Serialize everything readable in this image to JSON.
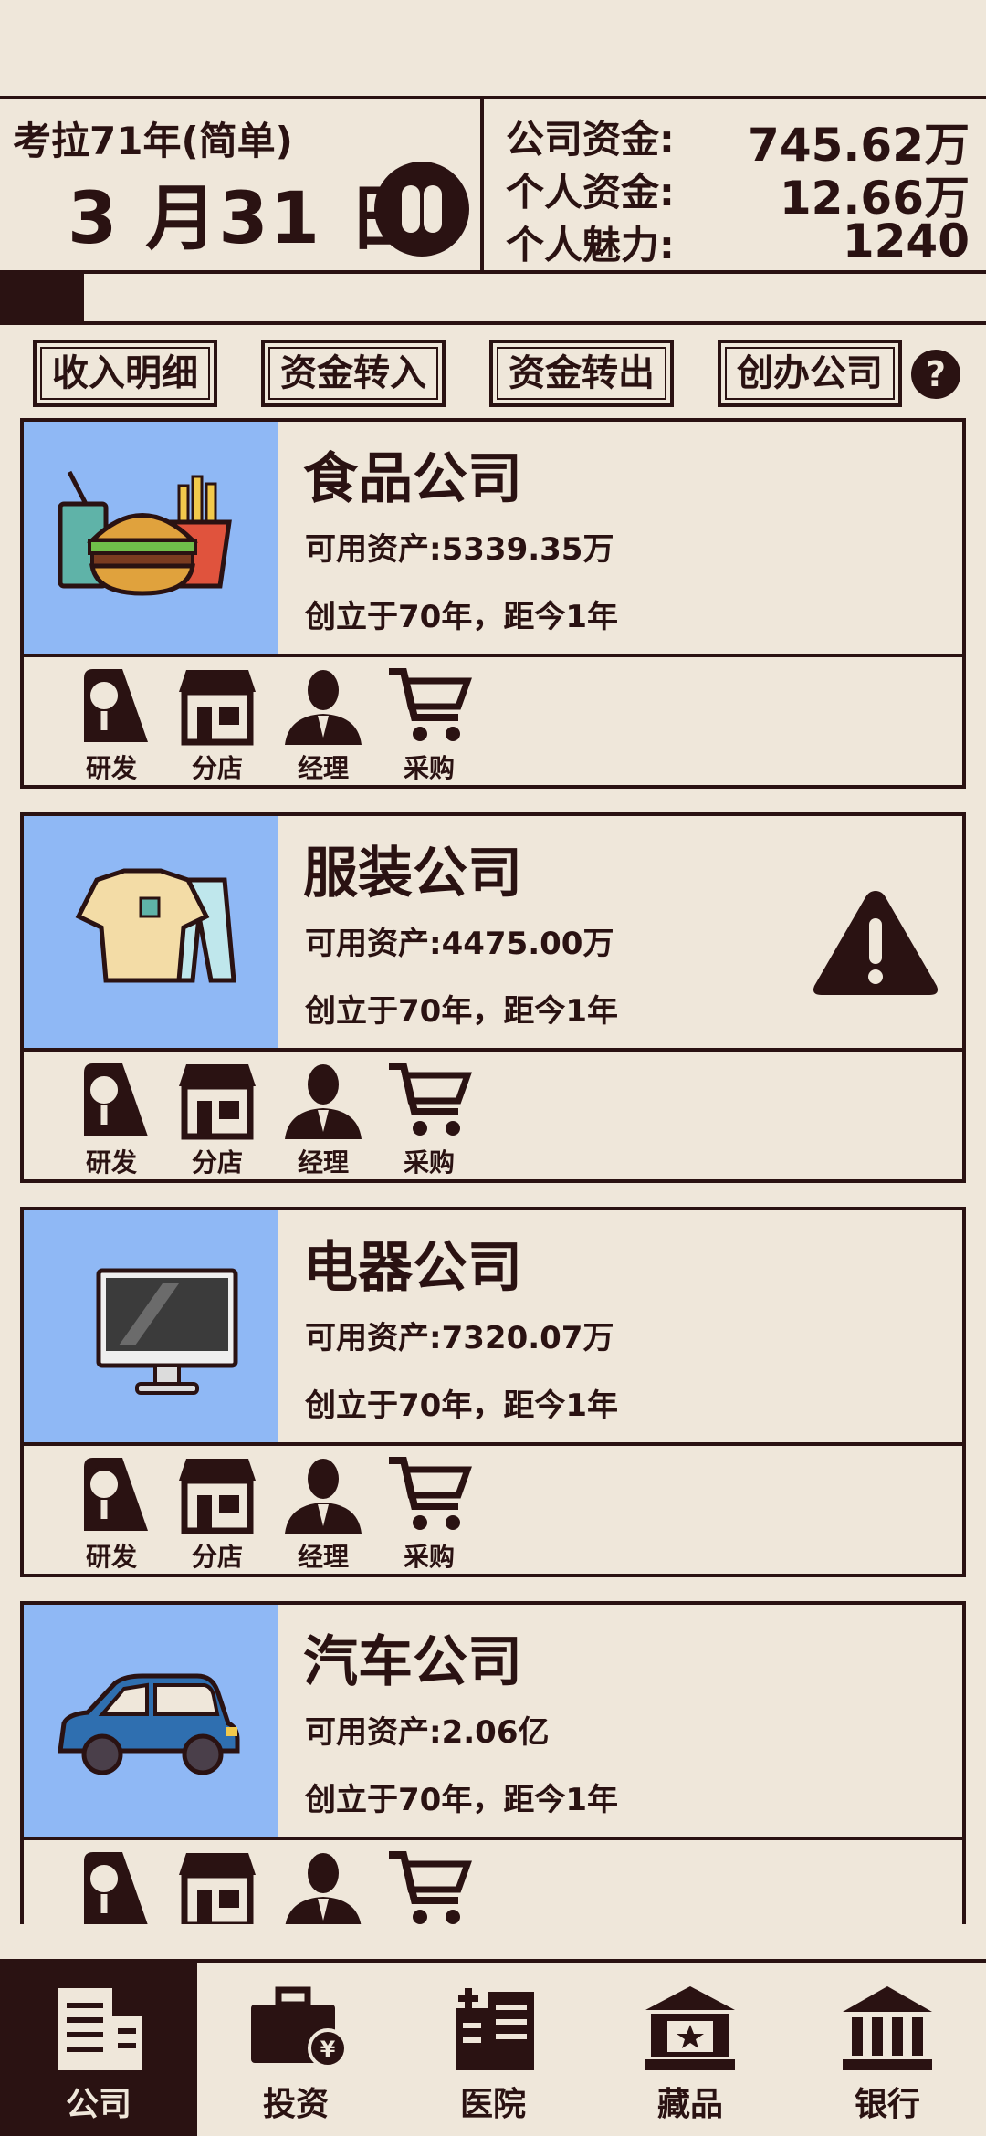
{
  "header": {
    "year_label": "考拉71年(简单)",
    "date_label": "3 月31 日",
    "company_funds_label": "公司资金:",
    "company_funds_value": "745.62万",
    "personal_funds_label": "个人资金:",
    "personal_funds_value": "12.66万",
    "charm_label": "个人魅力:",
    "charm_value": "1240",
    "month_progress": 0.085
  },
  "actions": {
    "income_detail": "收入明细",
    "transfer_in": "资金转入",
    "transfer_out": "资金转出",
    "found_company": "创办公司",
    "help": "?"
  },
  "tool_labels": {
    "research": "研发",
    "branch": "分店",
    "manager": "经理",
    "purchase": "采购"
  },
  "companies": [
    {
      "name": "食品公司",
      "assets": "可用资产:5339.35万",
      "founded": "创立于70年，距今1年",
      "icon": "burger-fries-icon",
      "warning": false
    },
    {
      "name": "服装公司",
      "assets": "可用资产:4475.00万",
      "founded": "创立于70年，距今1年",
      "icon": "clothing-icon",
      "warning": true
    },
    {
      "name": "电器公司",
      "assets": "可用资产:7320.07万",
      "founded": "创立于70年，距今1年",
      "icon": "monitor-icon",
      "warning": false
    },
    {
      "name": "汽车公司",
      "assets": "可用资产:2.06亿",
      "founded": "创立于70年，距今1年",
      "icon": "car-icon",
      "warning": false
    }
  ],
  "nav": [
    {
      "label": "公司",
      "icon": "company-building-icon",
      "active": true
    },
    {
      "label": "投资",
      "icon": "briefcase-yen-icon",
      "active": false
    },
    {
      "label": "医院",
      "icon": "hospital-icon",
      "active": false
    },
    {
      "label": "藏品",
      "icon": "museum-icon",
      "active": false
    },
    {
      "label": "银行",
      "icon": "bank-icon",
      "active": false
    }
  ],
  "colors": {
    "ink": "#2a1212",
    "paper": "#efe7da",
    "thumb_bg": "#8fb8f5"
  }
}
